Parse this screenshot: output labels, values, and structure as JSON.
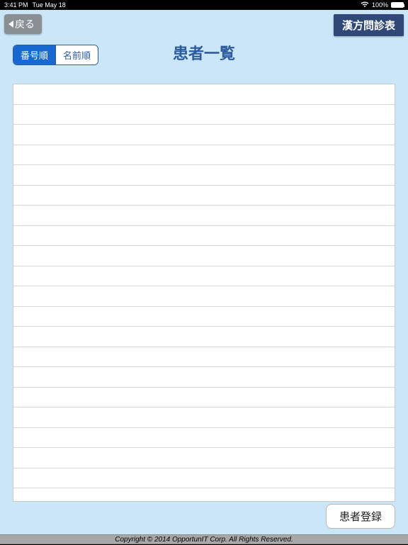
{
  "status": {
    "time": "3:41 PM",
    "date": "Tue May 18",
    "battery": "100%"
  },
  "back_label": "戻る",
  "app_title": "漢方問診表",
  "page_title": "患者一覧",
  "sort": {
    "by_number": "番号順",
    "by_name": "名前順"
  },
  "register_label": "患者登録",
  "footer": "Copyright © 2014 OpportunIT Corp. All Rights Reserved."
}
